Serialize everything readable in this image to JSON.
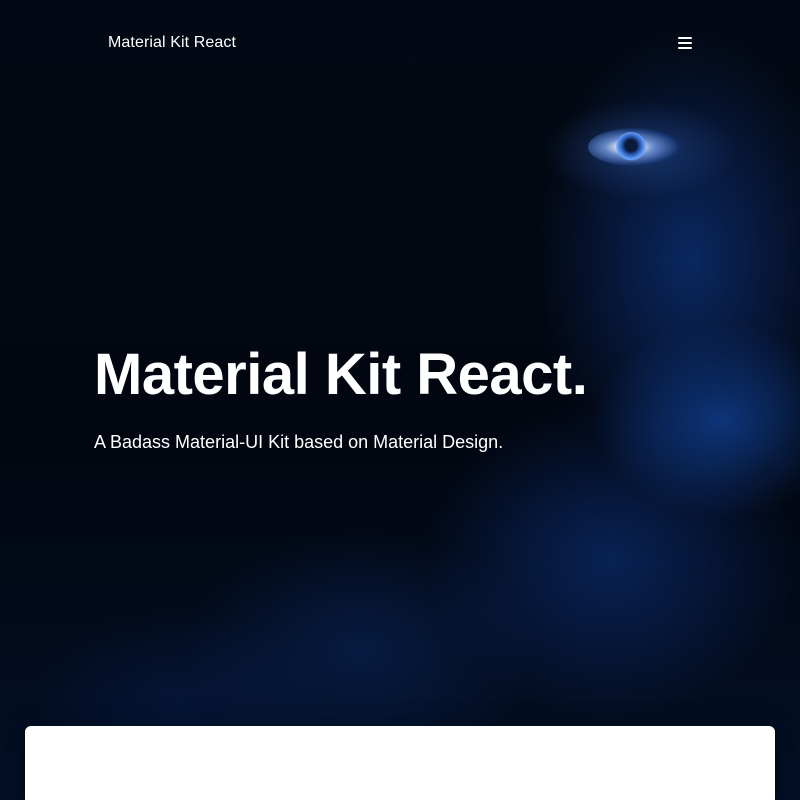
{
  "navbar": {
    "brand": "Material Kit React",
    "menu_icon": "hamburger-menu-icon"
  },
  "hero": {
    "title": "Material Kit React.",
    "subtitle": "A Badass Material-UI Kit based on Material Design."
  },
  "colors": {
    "text": "#ffffff",
    "background": "#02060f",
    "accent_blue": "#1f5fd1",
    "card": "#ffffff"
  }
}
